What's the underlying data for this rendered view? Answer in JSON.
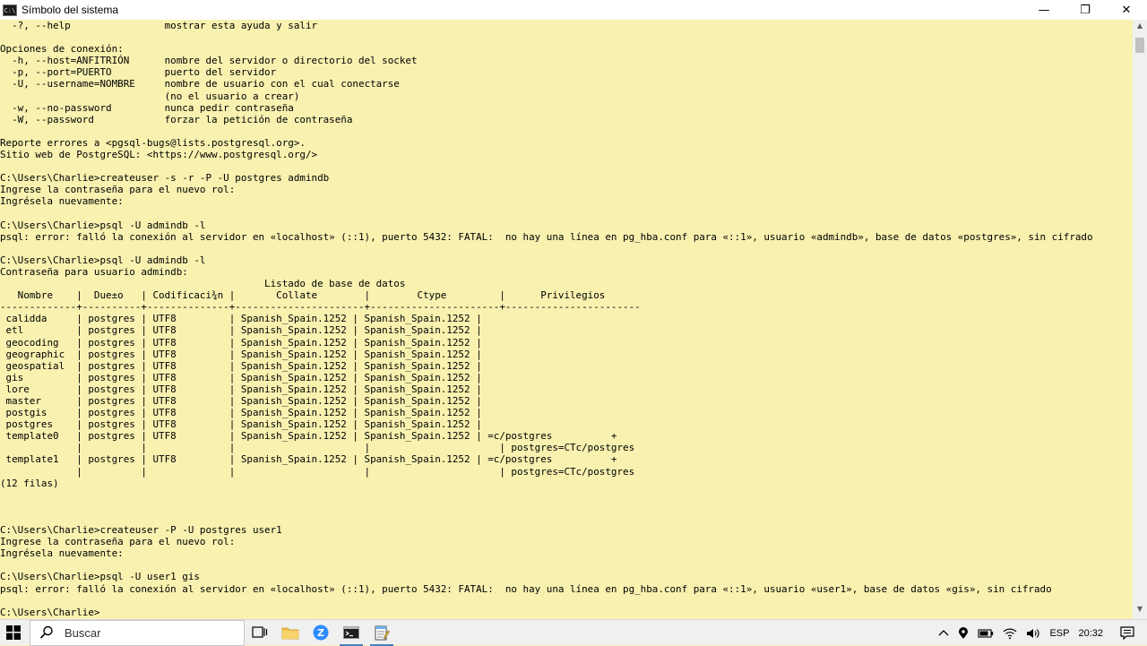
{
  "window": {
    "title": "Símbolo del sistema",
    "icon_label": "C:\\",
    "minimize": "—",
    "maximize": "❐",
    "close": "✕"
  },
  "console": {
    "lines": [
      "  -?, --help                mostrar esta ayuda y salir",
      "",
      "Opciones de conexión:",
      "  -h, --host=ANFITRIÓN      nombre del servidor o directorio del socket",
      "  -p, --port=PUERTO         puerto del servidor",
      "  -U, --username=NOMBRE     nombre de usuario con el cual conectarse",
      "                            (no el usuario a crear)",
      "  -w, --no-password         nunca pedir contraseña",
      "  -W, --password            forzar la petición de contraseña",
      "",
      "Reporte errores a <pgsql-bugs@lists.postgresql.org>.",
      "Sitio web de PostgreSQL: <https://www.postgresql.org/>",
      "",
      "C:\\Users\\Charlie>createuser -s -r -P -U postgres admindb",
      "Ingrese la contraseña para el nuevo rol:",
      "Ingrésela nuevamente:",
      "",
      "C:\\Users\\Charlie>psql -U admindb -l",
      "psql: error: falló la conexión al servidor en «localhost» (::1), puerto 5432: FATAL:  no hay una línea en pg_hba.conf para «::1», usuario «admindb», base de datos «postgres», sin cifrado",
      "",
      "C:\\Users\\Charlie>psql -U admindb -l",
      "Contraseña para usuario admindb:",
      "                                             Listado de base de datos",
      "   Nombre    |  Due±o   | Codificaci¾n |       Collate        |        Ctype         |      Privilegios",
      "-------------+----------+--------------+----------------------+----------------------+-----------------------",
      " calidda     | postgres | UTF8         | Spanish_Spain.1252 | Spanish_Spain.1252 |",
      " etl         | postgres | UTF8         | Spanish_Spain.1252 | Spanish_Spain.1252 |",
      " geocoding   | postgres | UTF8         | Spanish_Spain.1252 | Spanish_Spain.1252 |",
      " geographic  | postgres | UTF8         | Spanish_Spain.1252 | Spanish_Spain.1252 |",
      " geospatial  | postgres | UTF8         | Spanish_Spain.1252 | Spanish_Spain.1252 |",
      " gis         | postgres | UTF8         | Spanish_Spain.1252 | Spanish_Spain.1252 |",
      " lore        | postgres | UTF8         | Spanish_Spain.1252 | Spanish_Spain.1252 |",
      " master      | postgres | UTF8         | Spanish_Spain.1252 | Spanish_Spain.1252 |",
      " postgis     | postgres | UTF8         | Spanish_Spain.1252 | Spanish_Spain.1252 |",
      " postgres    | postgres | UTF8         | Spanish_Spain.1252 | Spanish_Spain.1252 |",
      " template0   | postgres | UTF8         | Spanish_Spain.1252 | Spanish_Spain.1252 | =c/postgres          +",
      "             |          |              |                      |                      | postgres=CTc/postgres",
      " template1   | postgres | UTF8         | Spanish_Spain.1252 | Spanish_Spain.1252 | =c/postgres          +",
      "             |          |              |                      |                      | postgres=CTc/postgres",
      "(12 filas)",
      "",
      "",
      "",
      "C:\\Users\\Charlie>createuser -P -U postgres user1",
      "Ingrese la contraseña para el nuevo rol:",
      "Ingrésela nuevamente:",
      "",
      "C:\\Users\\Charlie>psql -U user1 gis",
      "psql: error: falló la conexión al servidor en «localhost» (::1), puerto 5432: FATAL:  no hay una línea en pg_hba.conf para «::1», usuario «user1», base de datos «gis», sin cifrado",
      "",
      "C:\\Users\\Charlie>"
    ]
  },
  "taskbar": {
    "search_placeholder": "Buscar",
    "language": "ESP",
    "time": "20:32",
    "colors": {
      "taskbar_bg": "#f0f0f0",
      "console_bg": "#f8f1b0",
      "zoom_blue": "#2d8cff"
    }
  }
}
